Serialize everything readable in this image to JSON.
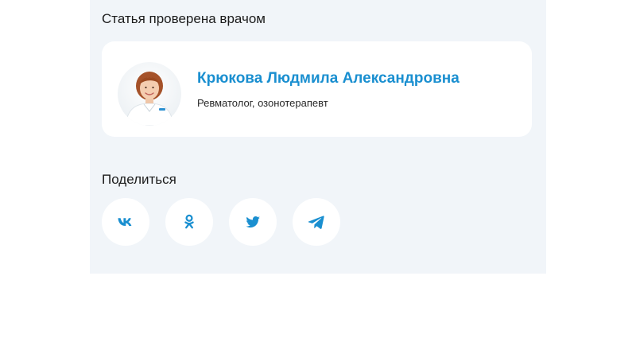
{
  "reviewed": {
    "title": "Статья проверена врачом"
  },
  "doctor": {
    "name": "Крюкова Людмила Александровна",
    "role": "Ревматолог, озонотерапевт",
    "avatar_icon": "doctor-photo"
  },
  "share": {
    "title": "Поделиться",
    "buttons": [
      {
        "icon": "vk-icon",
        "network": "VK"
      },
      {
        "icon": "odnoklassniki-icon",
        "network": "Odnoklassniki"
      },
      {
        "icon": "twitter-icon",
        "network": "Twitter"
      },
      {
        "icon": "telegram-icon",
        "network": "Telegram"
      }
    ]
  },
  "colors": {
    "accent": "#1a8fd0",
    "panel_bg": "#f1f5f9",
    "card_bg": "#ffffff",
    "text": "#1c1c1c"
  }
}
